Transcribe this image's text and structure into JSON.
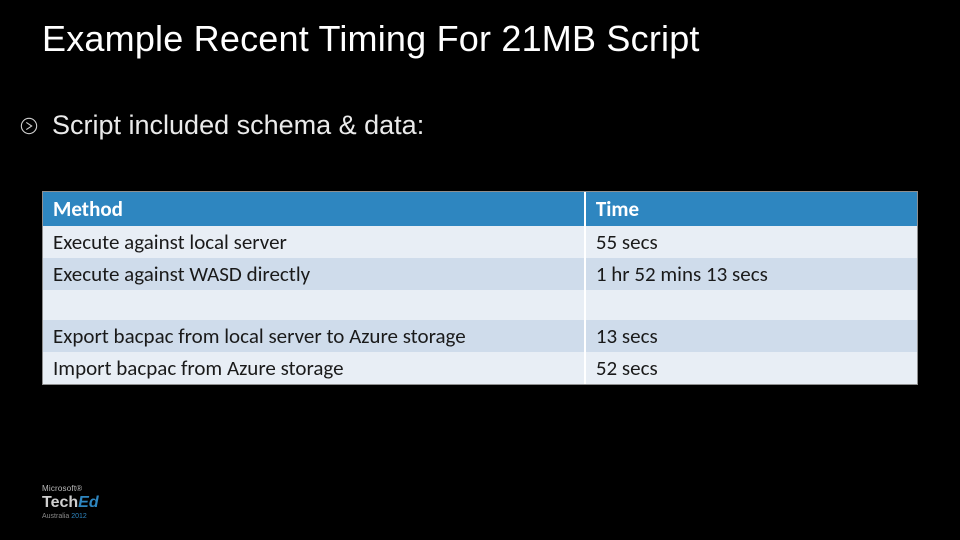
{
  "title": "Example Recent Timing For 21MB Script",
  "bullet": "Script included schema & data:",
  "table": {
    "headers": {
      "method": "Method",
      "time": "Time"
    },
    "rows": [
      {
        "method": "Execute against local server",
        "time": "55 secs"
      },
      {
        "method": "Execute against WASD directly",
        "time": "1 hr 52 mins 13 secs"
      },
      {
        "method": "",
        "time": ""
      },
      {
        "method": "Export bacpac from local server to Azure storage",
        "time": "13 secs"
      },
      {
        "method": "Import bacpac from Azure storage",
        "time": "52 secs"
      }
    ]
  },
  "footer": {
    "brand_small": "Microsoft®",
    "brand_main_a": "Tech",
    "brand_main_b": "Ed",
    "region": "Australia ",
    "year": "2012"
  },
  "colors": {
    "accent": "#2e86c0",
    "row_light": "#e8eef5",
    "row_dark": "#cfdceb"
  }
}
